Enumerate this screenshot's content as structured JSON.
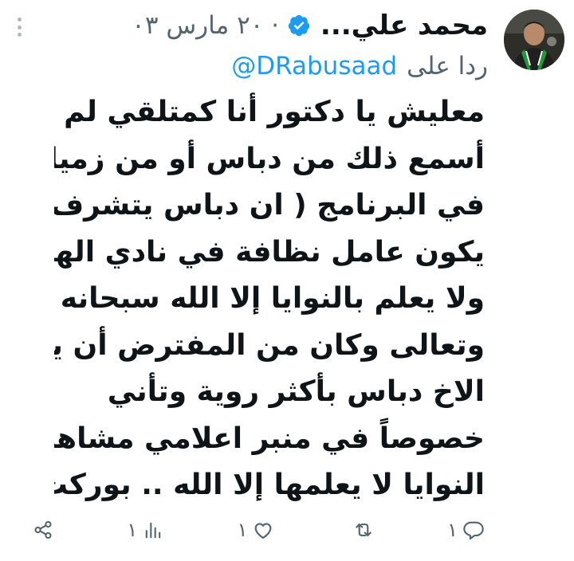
{
  "tweet": {
    "author_name": "محمد علي...",
    "date": "٢٠ مارس ٠٣",
    "separator": "·",
    "replying_to_prefix": "ردا على",
    "replying_to_handle": "@DRabusaad",
    "lines": [
      "معليش يا دكتور أنا كمتلقي لم",
      "أسمع ذلك من دباس أو من زميله",
      "في البرنامج ( ان دباس يتشرف ان",
      "يكون عامل نظافة في نادي الهلال)",
      "ولا يعلم بالنوايا إلا الله سبحانه",
      "وتعالى وكان من المفترض أن يرد",
      "الاخ دباس بأكثر روية وتأني",
      "خصوصاً في منبر اعلامي مشاهد.",
      "النوايا لا يعلمها إلا الله .. بوركت"
    ]
  },
  "actions": {
    "reply_count": "١",
    "retweet_count": "",
    "like_count": "١",
    "views_count": "١"
  },
  "icons": {
    "verified": "verified-badge-icon",
    "more": "more-options-icon",
    "reply": "reply-icon",
    "retweet": "retweet-icon",
    "like": "heart-icon",
    "views": "views-icon",
    "share": "share-icon"
  },
  "colors": {
    "text": "#0f1419",
    "secondary": "#536471",
    "accent": "#1d9bf0"
  }
}
